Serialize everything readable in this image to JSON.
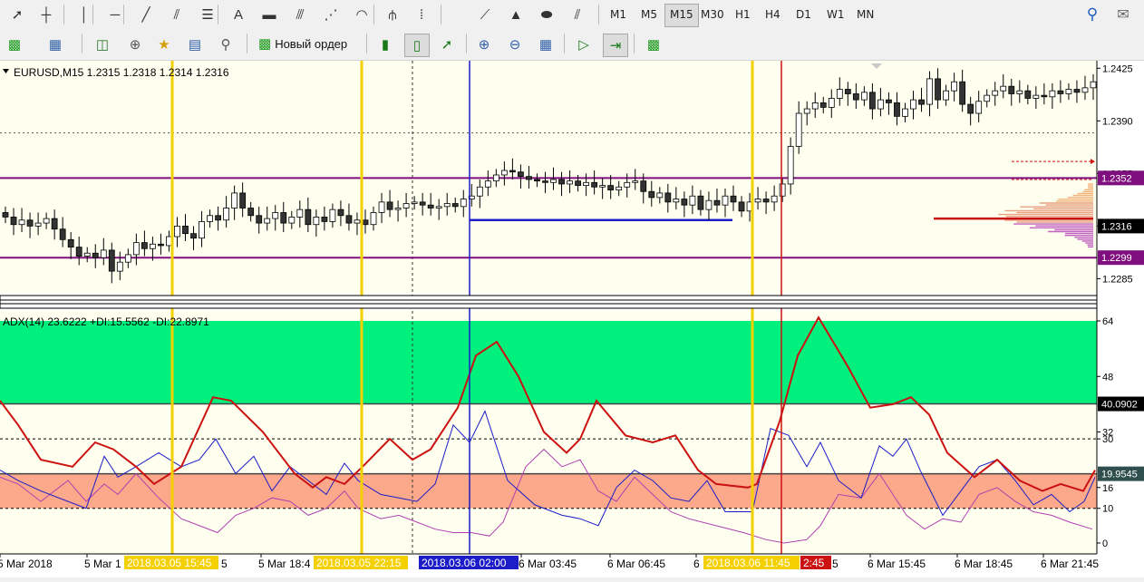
{
  "toolbar1": {
    "tools": [
      {
        "name": "cursor-arrow-icon",
        "glyph": "➚"
      },
      {
        "name": "crosshair-icon",
        "glyph": "┼"
      },
      {
        "name": "vertical-line-icon",
        "glyph": "│"
      },
      {
        "name": "horizontal-line-icon",
        "glyph": "─"
      },
      {
        "name": "trend-line-icon",
        "glyph": "╱"
      },
      {
        "name": "equidistant-channel-icon",
        "glyph": "⫽"
      },
      {
        "name": "fibonacci-retracement-icon",
        "glyph": "☰"
      },
      {
        "name": "text-tool-icon",
        "glyph": "A"
      },
      {
        "name": "text-label-icon",
        "glyph": "▬"
      },
      {
        "name": "fibonacci-channel-icon",
        "glyph": "⫻"
      },
      {
        "name": "fibonacci-fan-icon",
        "glyph": "⋰"
      },
      {
        "name": "fibonacci-arcs-icon",
        "glyph": "◠"
      },
      {
        "name": "andrews-pitchfork-icon",
        "glyph": "⫛"
      },
      {
        "name": "fibonacci-time-zones-icon",
        "glyph": "⦙"
      },
      {
        "name": "gann-fan-icon",
        "glyph": "⟋"
      },
      {
        "name": "triangle-icon",
        "glyph": "▲"
      },
      {
        "name": "ellipse-icon",
        "glyph": "⬬"
      },
      {
        "name": "regression-channel-icon",
        "glyph": "⫽"
      }
    ],
    "timeframes": [
      "M1",
      "M5",
      "M15",
      "M30",
      "H1",
      "H4",
      "D1",
      "W1",
      "MN"
    ],
    "active_timeframe": "M15"
  },
  "toolbar2": {
    "new_order_label": "Новый ордер"
  },
  "chart": {
    "symbol_header": "EURUSD,M15  1.2315 1.2318 1.2314 1.2316",
    "price_axis_labels": [
      "1.2425",
      "1.2390",
      "1.2355",
      "1.2320",
      "1.2285"
    ],
    "price_tags": {
      "level_high": "1.2352",
      "current": "1.2316",
      "level_low": "1.2299"
    },
    "indicator_header": "ADX(14) 23.6222 +DI:15.5562 -DI:22.8971",
    "indicator_axis_labels": [
      "64",
      "48",
      "32",
      "30",
      "16",
      "10",
      "0"
    ],
    "indicator_tags": {
      "upper_level": "40.0902",
      "lower_level": "19.9545"
    },
    "time_labels": [
      "5 Mar 2018",
      "5 Mar 1",
      "5 Mar 18:4",
      "6 Mar 03:45",
      "6 Mar 06:45",
      "6",
      "6 Mar 15:45",
      "6 Mar 18:45",
      "6 Mar 21:45"
    ],
    "time_tags": [
      {
        "text": "2018.03.05 15:45",
        "bg": "#f5d000",
        "fg": "#ffffff"
      },
      {
        "text": "2018.03.05 22:15",
        "bg": "#f5d000",
        "fg": "#ffffff"
      },
      {
        "text": "2018.03.06 02:00",
        "bg": "#1c1cc8",
        "fg": "#ffffff"
      },
      {
        "text": "2018.03.06 11:45",
        "bg": "#f5d000",
        "fg": "#ffffff"
      },
      {
        "text": "2:45",
        "bg": "#cc1111",
        "fg": "#ffffff"
      }
    ],
    "time_tag_suffix": "5",
    "colors": {
      "background": "#fffff0",
      "bull": "#ffffff",
      "bear": "#333333",
      "level": "#7f0f7f",
      "vline_yellow": "#f5d000",
      "vline_blue": "#1c1cc8",
      "vline_red": "#cc1111",
      "adx": "#cc1111",
      "plus_di": "#1c1cc8",
      "minus_di": "#b040b0",
      "zone_green": "#00f07e",
      "zone_salmon": "#fba98a"
    }
  }
}
